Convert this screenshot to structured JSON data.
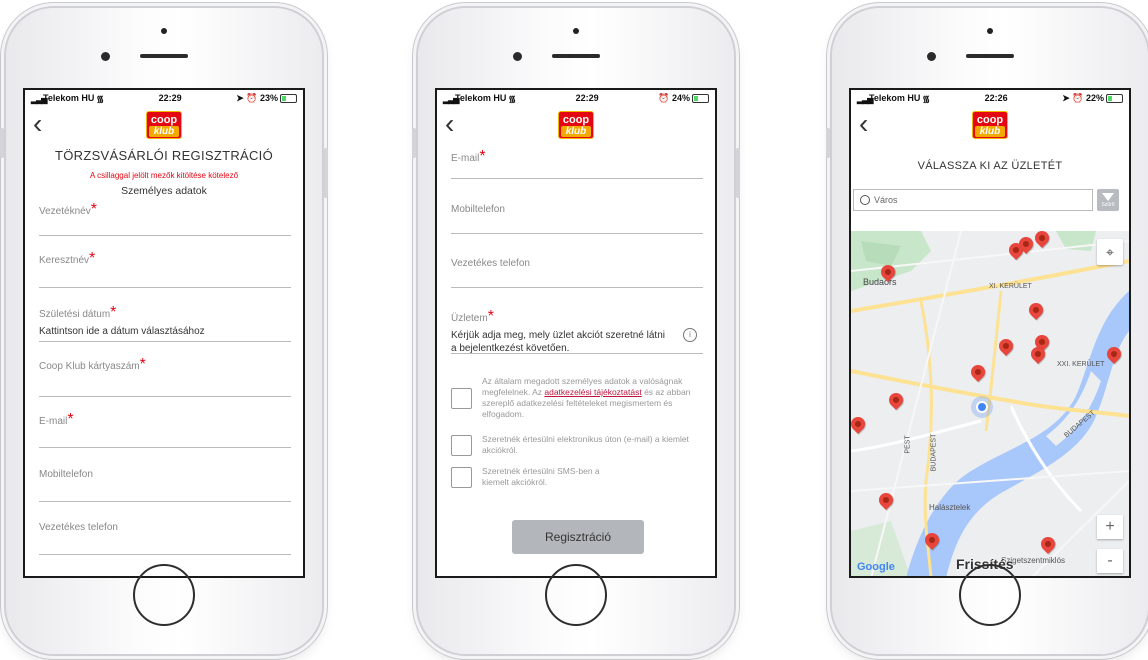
{
  "status": {
    "phone1": {
      "carrier": "Telekom HU",
      "time": "22:29",
      "battery": "23%"
    },
    "phone2": {
      "carrier": "Telekom HU",
      "time": "22:29",
      "battery": "24%"
    },
    "phone3": {
      "carrier": "Telekom HU",
      "time": "22:26",
      "battery": "22%"
    }
  },
  "logo": {
    "line1": "coop",
    "line2": "klub"
  },
  "registration": {
    "title": "TÖRZSVÁSÁRLÓI REGISZTRÁCIÓ",
    "required_note": "A csillaggal jelölt mezők kitöltése kötelező",
    "section_personal": "Személyes adatok",
    "fields": {
      "last_name": "Vezetéknév",
      "first_name": "Keresztnév",
      "birth_date": "Születési dátum",
      "birth_date_value": "Kattintson ide a dátum választásához",
      "card_number": "Coop Klub kártyaszám",
      "email": "E-mail",
      "mobile": "Mobiltelefon",
      "landline": "Vezetékes telefon",
      "store": "Üzletem",
      "store_value": "Kérjük adja meg, mely üzlet akciót szeretné látni a bejelentkezést követően."
    },
    "required_mark": "*",
    "consent_1_before": "Az általam megadott személyes adatok a valóságnak megfelelnek. Az ",
    "consent_1_link": "adatkezelési tájékoztatást",
    "consent_1_after": " és az abban szereplő adatkezelési feltételeket megismertem és elfogadom.",
    "consent_2": "Szeretnék értesülni elektronikus úton (e-mail) a kiemlet akciókról.",
    "consent_3": "Szeretnék értesülni SMS-ben a kiemelt akciókról.",
    "submit": "Regisztráció"
  },
  "store_select": {
    "title": "VÁLASSZA KI AZ ÜZLETÉT",
    "search_placeholder": "Város",
    "filter_label": "Szűrő",
    "map_labels": {
      "budaors": "Budaörs",
      "xi_kerulet": "XI. KERÜLET",
      "xxi_kerulet": "XXI. KERÜLET",
      "pest": "PEST",
      "budapest": "BUDAPEST",
      "budapest2": "BUDAPEST",
      "halasztelek": "Halásztelek",
      "szigetszentmiklos": "Szigetszentmiklós"
    },
    "google": "Google",
    "refresh": "Frissítés",
    "zoom_in": "+",
    "zoom_out": "-"
  },
  "icons": {
    "back": "chevron-left-icon",
    "search": "search-icon",
    "filter": "filter-icon",
    "locate": "locate-icon",
    "info": "info-icon",
    "pin": "map-pin-icon"
  },
  "colors": {
    "accent_red": "#e30613",
    "logo_yellow": "#f2a900",
    "button_gray": "#b3b7bc",
    "pin_red": "#e8453c"
  }
}
